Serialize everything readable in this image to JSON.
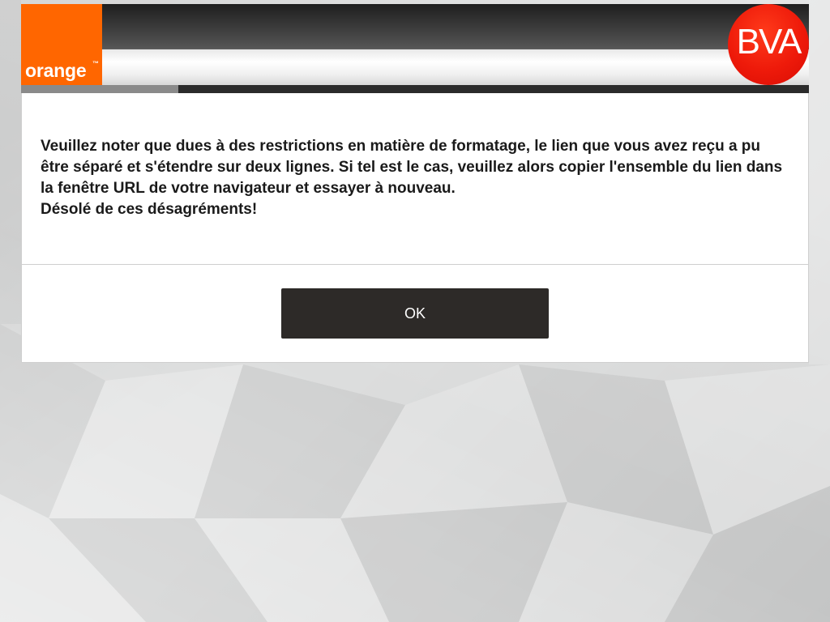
{
  "header": {
    "orange_logo": "orange",
    "orange_tm": "™",
    "bva_logo": "BVA",
    "colors": {
      "orange": "#ff6600",
      "bva_red": "#ee1a0a",
      "button": "#2d2a28"
    }
  },
  "progress": {
    "fraction": 0.2
  },
  "message": {
    "line1": "Veuillez noter que dues à des restrictions en matière de formatage, le lien que vous avez reçu a pu être séparé et s'étendre sur deux lignes. Si tel est le cas, veuillez alors copier l'ensemble du lien dans la fenêtre URL de votre navigateur et essayer à nouveau.",
    "line2": "Désolé de ces désagréments!"
  },
  "footer": {
    "ok_label": "OK"
  }
}
